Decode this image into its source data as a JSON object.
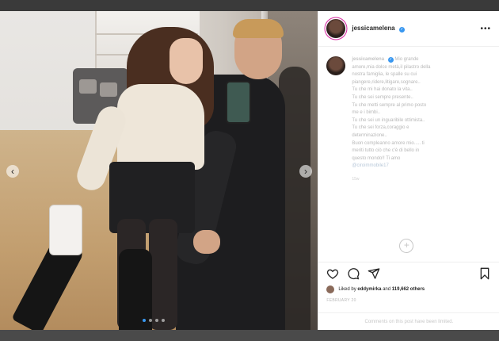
{
  "post": {
    "username": "jessicamelena",
    "more_label": "•••",
    "caption": {
      "username": "jessicamelena",
      "lines": [
        "Mio grande",
        "amore,mia dolce metà,il  pilastro della",
        "nostra famiglia, le spalle su cui",
        "piangere,ridere,litigare,sognare..",
        "Tu che mi hai donato la vita..",
        "Tu che sei sempre presente..",
        "Tu che metti sempre al primo posto",
        "me e i bimbi..",
        "Tu che sei un inguaribile ottimista..",
        "Tu che sei forza,coraggio e",
        "determinazione..",
        "Buon compleanno amore mio..... ti",
        "meriti tutto ciò che c'è di bello in",
        "questo mondo!! Ti amo"
      ],
      "mention": "@ciroimmobile17"
    },
    "time_ago": "15w",
    "likes_prefix": "Liked by",
    "likes_user": "eddymirka",
    "likes_mid": "and",
    "likes_count": "119,662 others",
    "posted_date": "FEBRUARY 20",
    "comments_limited": "Comments on this post have been limited."
  },
  "photo": {
    "prev_label": "‹",
    "next_label": "›",
    "carousel_count": 4,
    "active_index": 0
  },
  "colors": {
    "verified": "#3897f0",
    "ring": "#d6249f"
  },
  "icons": {
    "like": "heart-icon",
    "comment": "comment-icon",
    "share": "share-icon",
    "save": "bookmark-icon",
    "load_more": "plus-circle-icon",
    "verified": "verified-badge-icon"
  }
}
